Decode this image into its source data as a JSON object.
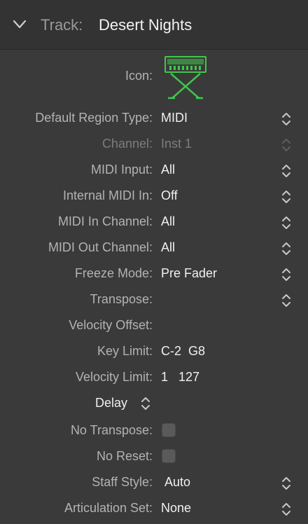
{
  "header": {
    "label": "Track:",
    "title": "Desert Nights"
  },
  "icon_row": {
    "label": "Icon:",
    "icon": "keyboard-stand-icon",
    "icon_color": "#3ec84a"
  },
  "rows": [
    {
      "label": "Default Region Type:",
      "value": "MIDI"
    },
    {
      "label": "Channel:",
      "value": "Inst 1"
    },
    {
      "label": "MIDI Input:",
      "value": "All"
    },
    {
      "label": "Internal MIDI In:",
      "value": "Off"
    },
    {
      "label": "MIDI In Channel:",
      "value": "All"
    },
    {
      "label": "MIDI Out Channel:",
      "value": "All"
    },
    {
      "label": "Freeze Mode:",
      "value": "Pre Fader"
    },
    {
      "label": "Transpose:",
      "value": ""
    },
    {
      "label": "Velocity Offset:",
      "value": ""
    },
    {
      "label": "Key Limit:",
      "value": "C-2  G8"
    },
    {
      "label": "Velocity Limit:",
      "value": "1   127"
    }
  ],
  "delay": {
    "label": "Delay"
  },
  "checks": [
    {
      "label": "No Transpose:",
      "checked": false
    },
    {
      "label": "No Reset:",
      "checked": false
    }
  ],
  "bottom_rows": [
    {
      "label": "Staff Style:",
      "value": "Auto"
    },
    {
      "label": "Articulation Set:",
      "value": "None"
    }
  ],
  "colors": {
    "background": "#3a3a3a",
    "header": "#333333",
    "label": "#b3b3b3",
    "value": "#f0f0f0",
    "disabled": "#7d7d7d"
  }
}
